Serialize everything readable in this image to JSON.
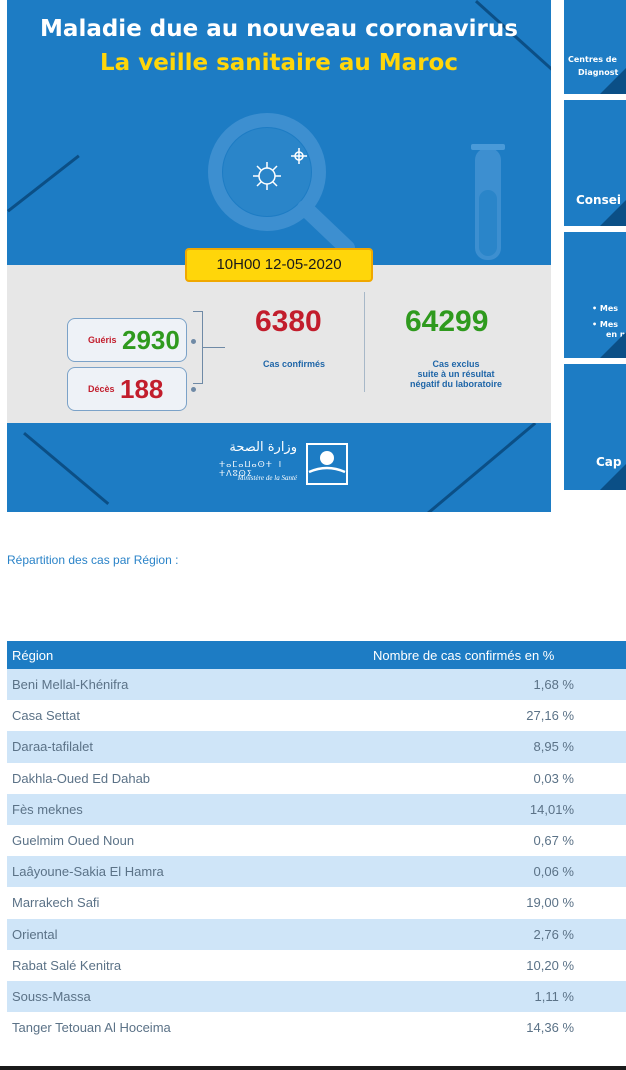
{
  "banner": {
    "title_line1": "Maladie due au nouveau coronavirus",
    "title_line2": "La veille sanitaire au Maroc",
    "date": "10H00  12-05-2020",
    "recovered": {
      "label": "Guéris",
      "value": "2930"
    },
    "deaths": {
      "label": "Décès",
      "value": "188"
    },
    "confirmed": {
      "value": "6380",
      "label": "Cas confirmés"
    },
    "excluded": {
      "value": "64299",
      "label_line1": "Cas exclus",
      "label_line2": "suite à un résultat",
      "label_line3": "négatif du laboratoire"
    },
    "ministry": {
      "arabic": "وزارة الصحة",
      "tifinagh": "ⵜⴰⵎⴰⵡⴰⵙⵜ ⵏ ⵜⴷⵓⵙⵉ",
      "french": "Ministère de la Santé"
    }
  },
  "side_cards": [
    {
      "line1": "Centres de",
      "line2": "Diagnost"
    },
    {
      "line1": "Consei"
    },
    {
      "line1": "• Mes",
      "line2": "• Mes",
      "line3": "en m"
    },
    {
      "line1": "Cap"
    }
  ],
  "region_section": {
    "title": "Répartition des cas par Région :",
    "columns": [
      "Région",
      "Nombre de cas confirmés en %"
    ],
    "rows": [
      {
        "region": "Beni Mellal-Khénifra",
        "pct": "1,68 %"
      },
      {
        "region": "Casa Settat",
        "pct": "27,16 %"
      },
      {
        "region": "Daraa-tafilalet",
        "pct": "8,95 %"
      },
      {
        "region": "Dakhla-Oued Ed Dahab",
        "pct": "0,03 %"
      },
      {
        "region": "Fès meknes",
        "pct": "14,01%"
      },
      {
        "region": "Guelmim Oued Noun",
        "pct": "0,67 %"
      },
      {
        "region": "Laâyoune-Sakia El Hamra",
        "pct": "0,06 %"
      },
      {
        "region": "Marrakech Safi",
        "pct": "19,00 %"
      },
      {
        "region": "Oriental",
        "pct": "2,76 %"
      },
      {
        "region": "Rabat Salé Kenitra",
        "pct": "10,20 %"
      },
      {
        "region": "Souss-Massa",
        "pct": "1,11 %"
      },
      {
        "region": "Tanger Tetouan Al Hoceima",
        "pct": "14,36 %"
      }
    ]
  },
  "colors": {
    "brand_blue": "#1d7cc4",
    "dark_blue": "#0b4f86",
    "yellow": "#ffd60a",
    "red": "#c21d2c",
    "green": "#2f9a1e",
    "row_highlight": "#cfe5f8"
  },
  "icons": [
    "magnifier-icon",
    "virus-icon",
    "test-tube-icon",
    "ministry-logo-icon"
  ]
}
